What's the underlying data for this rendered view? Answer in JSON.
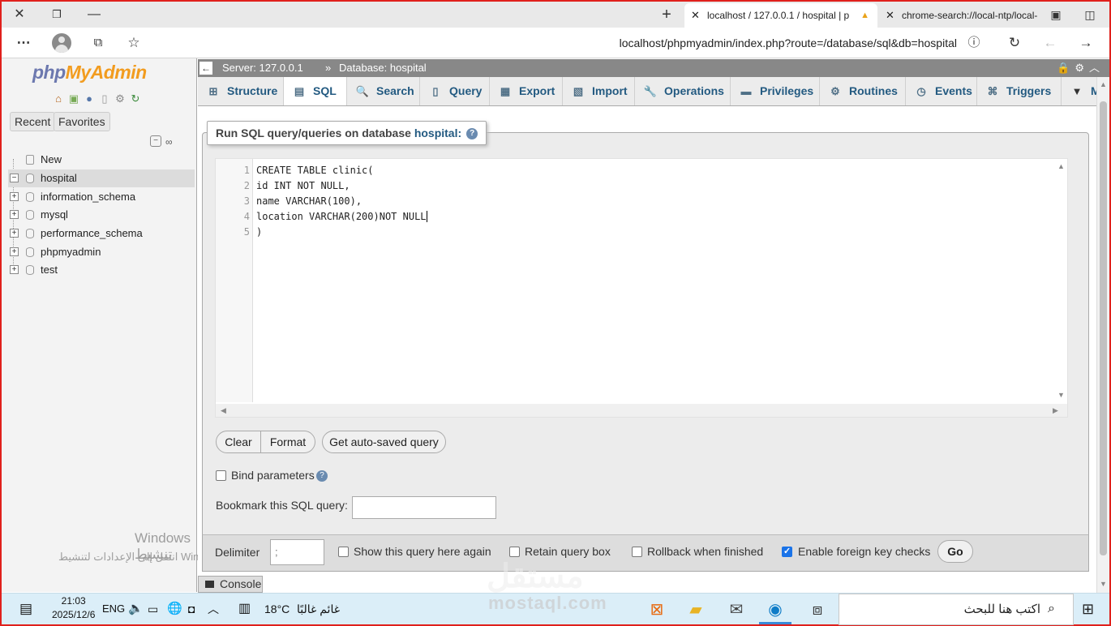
{
  "browser": {
    "tabs": [
      {
        "title": "localhost / 127.0.0.1 / hospital | p",
        "active": true
      },
      {
        "title": "chrome-search://local-ntp/local-",
        "active": false
      }
    ],
    "url": "localhost/phpmyadmin/index.php?route=/database/sql&db=hospital"
  },
  "nav": {
    "logo_php": "php",
    "logo_myadmin": "MyAdmin",
    "recent_label": "Recent",
    "favorites_label": "Favorites",
    "tree": [
      {
        "label": "New",
        "expander": "",
        "selected": false
      },
      {
        "label": "hospital",
        "expander": "−",
        "selected": true
      },
      {
        "label": "information_schema",
        "expander": "+",
        "selected": false
      },
      {
        "label": "mysql",
        "expander": "+",
        "selected": false
      },
      {
        "label": "performance_schema",
        "expander": "+",
        "selected": false
      },
      {
        "label": "phpmyadmin",
        "expander": "+",
        "selected": false
      },
      {
        "label": "test",
        "expander": "+",
        "selected": false
      }
    ],
    "watermark_title": "Windows تنشيط",
    "watermark_sub": "انتقل إلى الإعدادات لتنشيط Windows."
  },
  "breadcrumb": {
    "server": "Server: 127.0.0.1",
    "sep": "»",
    "database": "Database: hospital"
  },
  "tabs": [
    {
      "label": "Structure",
      "icon": "structure-icon",
      "glyph": "⊞"
    },
    {
      "label": "SQL",
      "icon": "sql-icon",
      "glyph": "▤",
      "active": true
    },
    {
      "label": "Search",
      "icon": "search-icon",
      "glyph": "🔍"
    },
    {
      "label": "Query",
      "icon": "query-icon",
      "glyph": "▯"
    },
    {
      "label": "Export",
      "icon": "export-icon",
      "glyph": "▦"
    },
    {
      "label": "Import",
      "icon": "import-icon",
      "glyph": "▧"
    },
    {
      "label": "Operations",
      "icon": "wrench-icon",
      "glyph": "🔧"
    },
    {
      "label": "Privileges",
      "icon": "privileges-icon",
      "glyph": "▬"
    },
    {
      "label": "Routines",
      "icon": "routines-icon",
      "glyph": "⚙"
    },
    {
      "label": "Events",
      "icon": "clock-icon",
      "glyph": "◷"
    },
    {
      "label": "Triggers",
      "icon": "triggers-icon",
      "glyph": "⌘"
    },
    {
      "label": "M",
      "icon": "more-icon",
      "glyph": "▼"
    }
  ],
  "sql_panel": {
    "title_prefix": "Run SQL query/queries on database",
    "database": "hospital:",
    "lines": [
      {
        "no": "1",
        "text": "CREATE TABLE clinic("
      },
      {
        "no": "2",
        "text": "id INT NOT NULL,"
      },
      {
        "no": "3",
        "text": "name VARCHAR(100),"
      },
      {
        "no": "4",
        "text": "location VARCHAR(200)NOT NULL"
      },
      {
        "no": "5",
        "text": ")"
      }
    ],
    "clear_label": "Clear",
    "format_label": "Format",
    "autosaved_label": "Get auto-saved query",
    "bind_params_label": "Bind parameters",
    "bookmark_label": "Bookmark this SQL query:",
    "bookmark_value": ""
  },
  "footer": {
    "delimiter_label": "Delimiter",
    "delimiter_value": ";",
    "show_query_label": "Show this query here again",
    "retain_label": "Retain query box",
    "rollback_label": "Rollback when finished",
    "fk_label": "Enable foreign key checks",
    "fk_checked": true,
    "go_label": "Go"
  },
  "console_label": "Console",
  "taskbar": {
    "time": "21:03",
    "date": "2025/12/6",
    "lang": "ENG",
    "weather": "18°C",
    "weather_text": "غائم غالبًا",
    "search_placeholder": "اكتب هنا للبحث"
  },
  "overlay": {
    "mostaql": "مستقل",
    "mostaql_url": "mostaql.com"
  }
}
